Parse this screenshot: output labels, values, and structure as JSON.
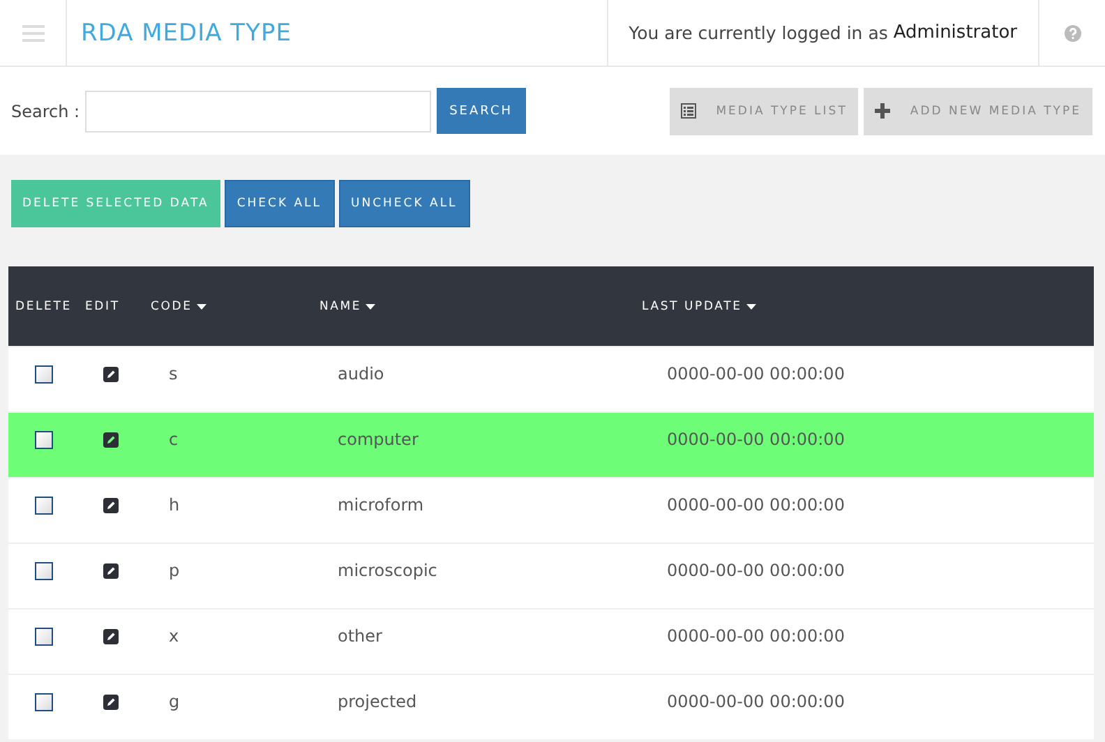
{
  "header": {
    "title": "RDA MEDIA TYPE",
    "login_text": "You are currently logged in as",
    "user": "Administrator"
  },
  "search": {
    "label": "Search :",
    "button": "SEARCH"
  },
  "actions": [
    {
      "kind": "list",
      "label": "MEDIA TYPE LIST"
    },
    {
      "kind": "add",
      "label": "ADD NEW MEDIA TYPE"
    }
  ],
  "bulk_buttons": [
    {
      "kind": "danger",
      "label": "DELETE SELECTED DATA"
    },
    {
      "kind": "primary",
      "label": "CHECK ALL"
    },
    {
      "kind": "primary",
      "label": "UNCHECK ALL"
    }
  ],
  "table": {
    "columns": [
      {
        "label": "DELETE",
        "sortable": false
      },
      {
        "label": "EDIT",
        "sortable": false
      },
      {
        "label": "CODE",
        "sortable": true
      },
      {
        "label": "NAME",
        "sortable": true
      },
      {
        "label": "LAST UPDATE",
        "sortable": true
      }
    ],
    "rows": [
      {
        "code": "s",
        "name": "audio",
        "last_update": "0000-00-00 00:00:00",
        "checked": false,
        "highlighted": false
      },
      {
        "code": "c",
        "name": "computer",
        "last_update": "0000-00-00 00:00:00",
        "checked": false,
        "highlighted": true
      },
      {
        "code": "h",
        "name": "microform",
        "last_update": "0000-00-00 00:00:00",
        "checked": false,
        "highlighted": false
      },
      {
        "code": "p",
        "name": "microscopic",
        "last_update": "0000-00-00 00:00:00",
        "checked": false,
        "highlighted": false
      },
      {
        "code": "x",
        "name": "other",
        "last_update": "0000-00-00 00:00:00",
        "checked": false,
        "highlighted": false
      },
      {
        "code": "g",
        "name": "projected",
        "last_update": "0000-00-00 00:00:00",
        "checked": false,
        "highlighted": false
      }
    ]
  }
}
